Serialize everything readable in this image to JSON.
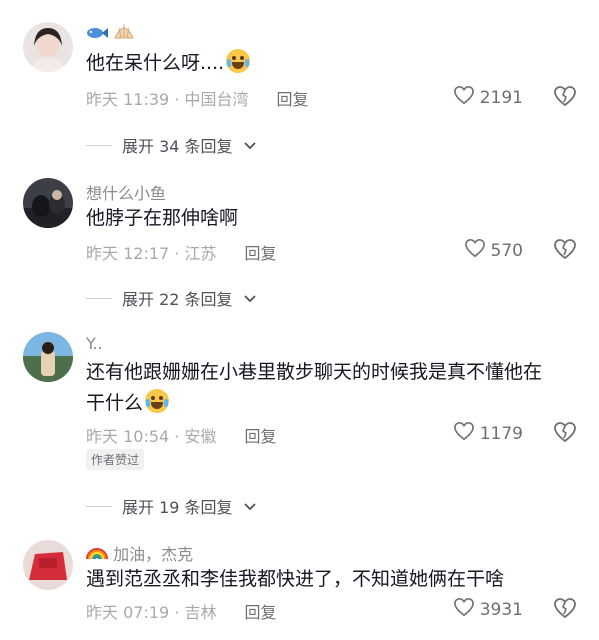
{
  "comments": [
    {
      "username": "",
      "name_emojis": [
        "fish-icon",
        "shell-icon"
      ],
      "text": "他在呆什么呀....",
      "text_emoji": "crying-laughing-emoji",
      "time_loc": "昨天 11:39 · 中国台湾",
      "reply": "回复",
      "likes": "2191",
      "expand_label": "展开 34 条回复"
    },
    {
      "username": "想什么小鱼",
      "text": "他脖子在那伸啥啊",
      "time_loc": "昨天 12:17 · 江苏",
      "reply": "回复",
      "likes": "570",
      "expand_label": "展开 22 条回复"
    },
    {
      "username": "Y..",
      "text_line1": "还有他跟姗姗在小巷里散步聊天的时候我是真不懂他在",
      "text_line2": "干什么",
      "text_emoji": "crying-laughing-emoji",
      "time_loc": "昨天 10:54 · 安徽",
      "reply": "回复",
      "likes": "1179",
      "badge": "作者赞过",
      "expand_label": "展开 19 条回复"
    },
    {
      "username": "加油，杰克",
      "name_emoji": "rainbow-icon",
      "text": "遇到范丞丞和李佳我都快进了，不知道她俩在干啥",
      "time_loc": "昨天 07:19 · 吉林",
      "reply": "回复",
      "likes": "3931"
    }
  ],
  "colors": {
    "text": "#161823",
    "meta": "#a8a9ae",
    "username": "#8a8b91"
  }
}
